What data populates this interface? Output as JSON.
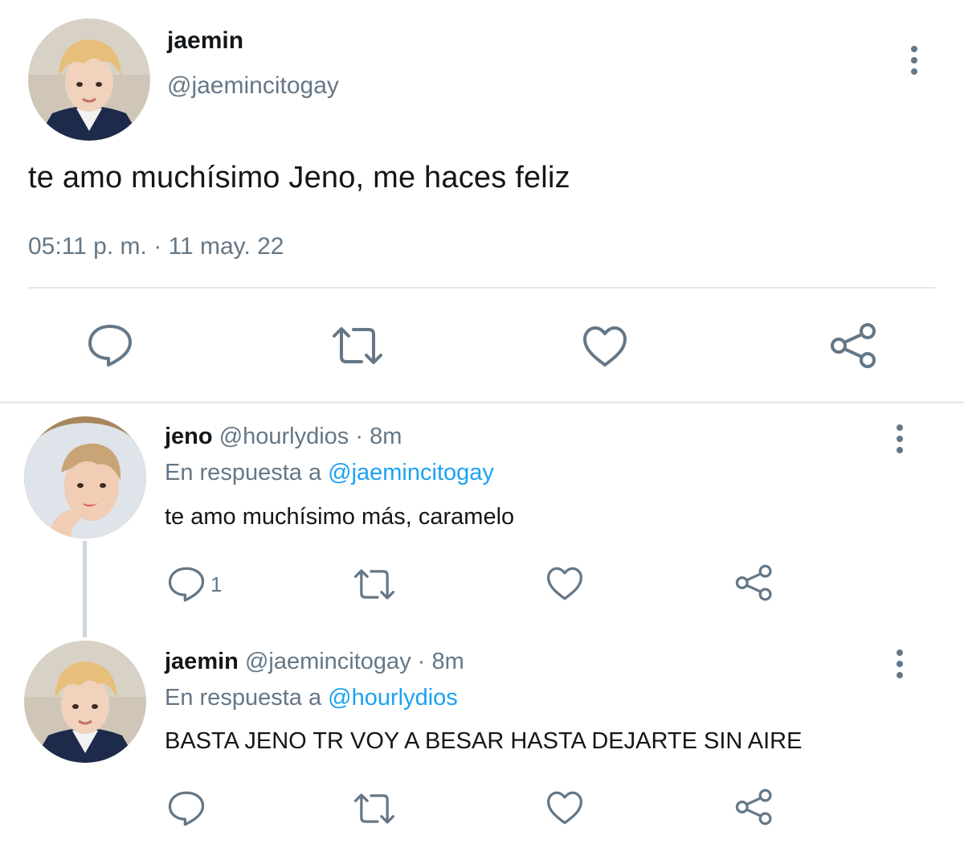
{
  "main_tweet": {
    "author_name": "jaemin",
    "handle": "@jaemincitogay",
    "text": "te amo muchísimo Jeno, me haces feliz",
    "timestamp": "05:11 p. m. · 11 may. 22"
  },
  "replies": [
    {
      "author_name": "jeno",
      "handle": "@hourlydios",
      "time": "· 8m",
      "reply_prefix": "En respuesta a",
      "reply_to": "@jaemincitogay",
      "text": "te amo muchísimo más, caramelo",
      "reply_count": "1"
    },
    {
      "author_name": "jaemin",
      "handle": "@jaemincitogay",
      "time": "· 8m",
      "reply_prefix": "En respuesta a",
      "reply_to": "@hourlydios",
      "text": "BASTA JENO TR VOY A BESAR HASTA DEJARTE SIN AIRE",
      "reply_count": ""
    }
  ],
  "colors": {
    "text": "#14171a",
    "secondary": "#657786",
    "link": "#1da1f2",
    "divider": "#e1e8ed",
    "thread_line": "#ccd6dd"
  },
  "icons": [
    "reply-icon",
    "retweet-icon",
    "like-icon",
    "share-icon",
    "more-options-icon"
  ]
}
